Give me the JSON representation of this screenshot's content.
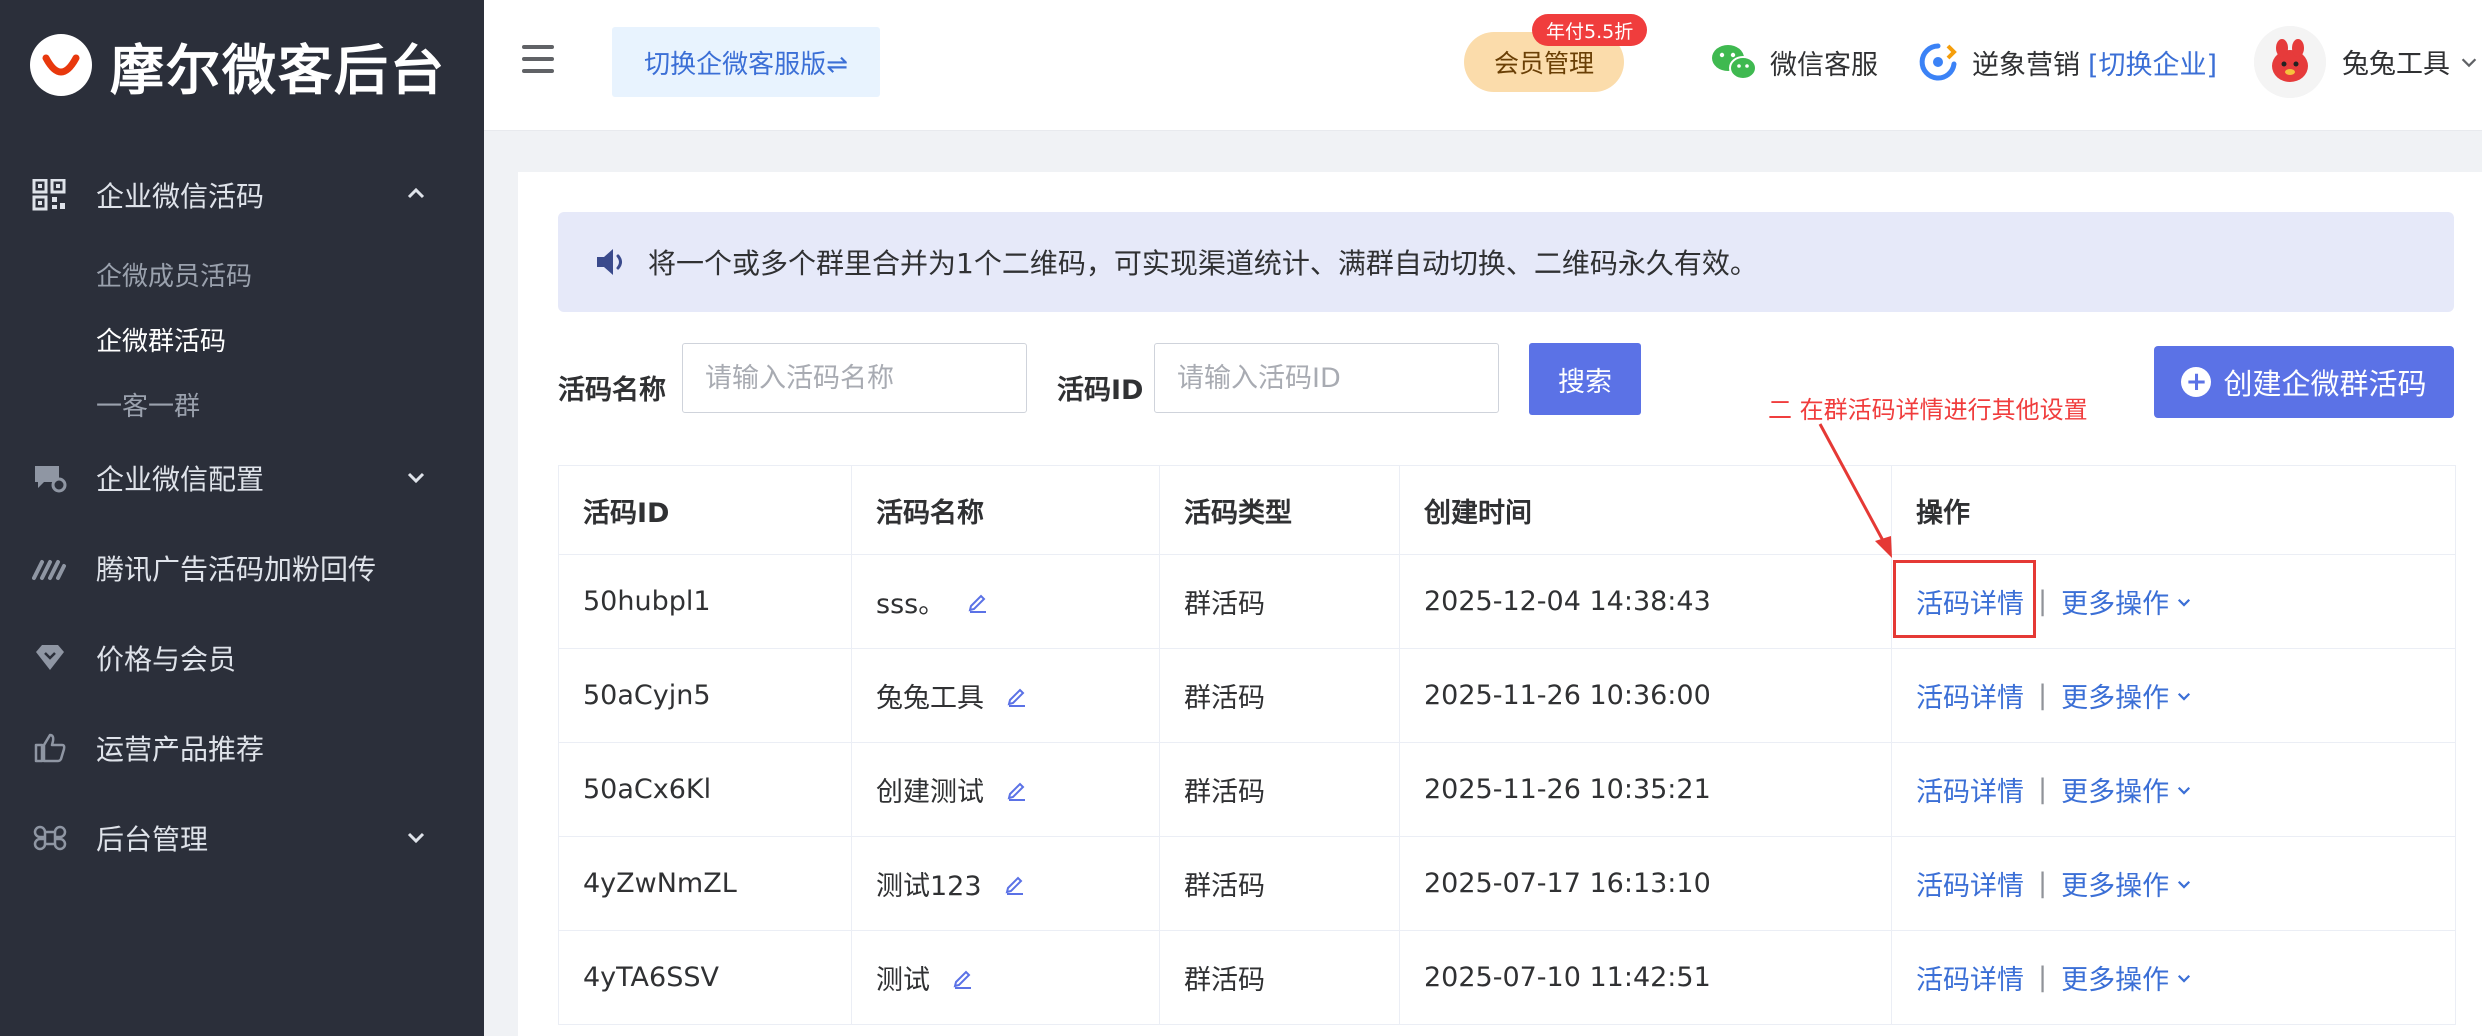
{
  "brand": {
    "title": "摩尔微客后台"
  },
  "sidebar": {
    "items": [
      {
        "label": "企业微信活码",
        "icon": "qrcode-icon",
        "expanded": true,
        "children": [
          "企微成员活码",
          "企微群活码",
          "一客一群"
        ],
        "active_child": "企微群活码"
      },
      {
        "label": "企业微信配置",
        "icon": "chat-gear-icon"
      },
      {
        "label": "腾讯广告活码加粉回传",
        "icon": "ad-stripes-icon"
      },
      {
        "label": "价格与会员",
        "icon": "diamond-icon"
      },
      {
        "label": "运营产品推荐",
        "icon": "thumbs-up-icon"
      },
      {
        "label": "后台管理",
        "icon": "command-icon"
      }
    ]
  },
  "header": {
    "switch_label": "切换企微客服版⇌",
    "member_label": "会员管理",
    "member_badge": "年付5.5折",
    "wechat_service": "微信客服",
    "marketing_label": "逆象营销",
    "switch_company": "[切换企业]",
    "user_name": "兔兔工具"
  },
  "notice": {
    "text": "将一个或多个群里合并为1个二维码，可实现渠道统计、满群自动切换、二维码永久有效。"
  },
  "filters": {
    "name_label": "活码名称",
    "name_placeholder": "请输入活码名称",
    "id_label": "活码ID",
    "id_placeholder": "请输入活码ID",
    "search_label": "搜索",
    "create_label": "创建企微群活码"
  },
  "annotation": {
    "text": "二  在群活码详情进行其他设置"
  },
  "table": {
    "headers": [
      "活码ID",
      "活码名称",
      "活码类型",
      "创建时间",
      "操作"
    ],
    "rows": [
      {
        "id": "50hubpl1",
        "name": "sss。",
        "type": "群活码",
        "created": "2025-12-04 14:38:43"
      },
      {
        "id": "50aCyjn5",
        "name": "兔兔工具",
        "type": "群活码",
        "created": "2025-11-26 10:36:00"
      },
      {
        "id": "50aCx6Kl",
        "name": "创建测试",
        "type": "群活码",
        "created": "2025-11-26 10:35:21"
      },
      {
        "id": "4yZwNmZL",
        "name": "测试123",
        "type": "群活码",
        "created": "2025-07-17 16:13:10"
      },
      {
        "id": "4yTA6SSV",
        "name": "测试",
        "type": "群活码",
        "created": "2025-07-10 11:42:51"
      }
    ],
    "op_detail": "活码详情",
    "op_sep": "|",
    "op_more": "更多操作"
  },
  "colors": {
    "accent": "#5b72e6",
    "sidebar_bg": "#2b2f3a",
    "annotation_red": "#f03d3d"
  }
}
